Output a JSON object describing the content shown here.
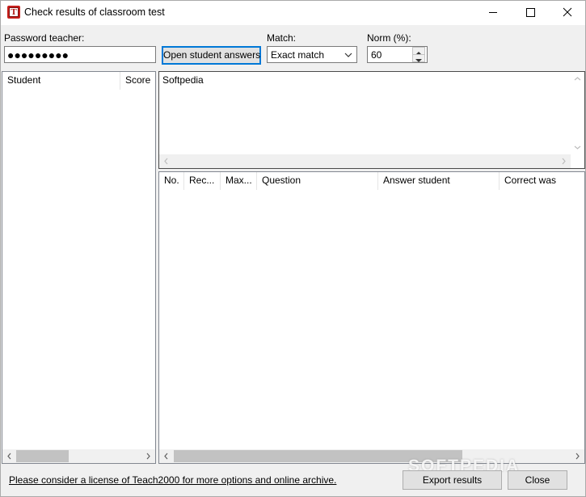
{
  "window": {
    "title": "Check results of classroom test",
    "icon_letter": "T"
  },
  "form": {
    "password_label": "Password teacher:",
    "password_dots": "●●●●●●●●●",
    "open_button": "Open student answers",
    "match_label": "Match:",
    "match_value": "Exact match",
    "norm_label": "Norm (%):",
    "norm_value": "60"
  },
  "student_list": {
    "columns": [
      "Student",
      "Score"
    ]
  },
  "preview": {
    "text": "Softpedia"
  },
  "answers_table": {
    "columns": [
      "No.",
      "Rec...",
      "Max...",
      "Question",
      "Answer student",
      "Correct was"
    ]
  },
  "footer": {
    "license_link": "Please consider a license of Teach2000 for more options and online archive.",
    "export_button": "Export results",
    "close_button": "Close",
    "watermark": "SOFTPEDIA"
  },
  "colors": {
    "accent": "#0078d7",
    "icon_red": "#c8201c"
  }
}
